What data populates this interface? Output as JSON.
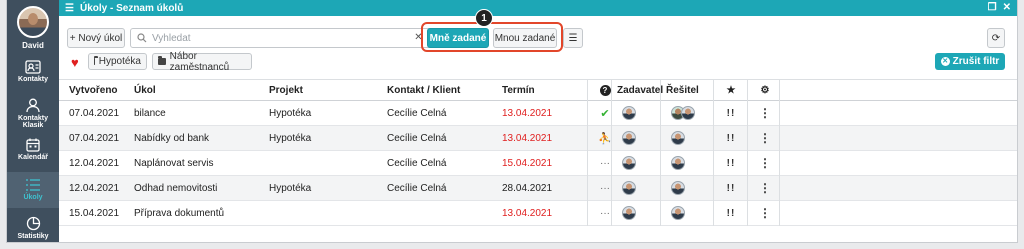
{
  "sidebar": {
    "user_name": "David",
    "items": [
      {
        "label": "Kontakty",
        "icon": "contacts-card-icon"
      },
      {
        "label": "Kontakty Klasik",
        "icon": "person-icon"
      },
      {
        "label": "Kalendář",
        "icon": "calendar-icon"
      },
      {
        "label": "Úkoly",
        "icon": "tasks-list-icon",
        "active": true
      },
      {
        "label": "Statistiky",
        "icon": "pie-chart-icon"
      }
    ]
  },
  "window": {
    "title": "Úkoly - Seznam úkolů",
    "accent_color": "#1da7b6"
  },
  "toolbar": {
    "new_task": "+ Nový úkol",
    "search_placeholder": "Vyhledat",
    "assigned_to_me": "Mně zadané",
    "assigned_by_me": "Mnou zadané",
    "badge": "1"
  },
  "filters": {
    "tags": [
      "Hypotéka",
      "Nábor zaměstnanců"
    ],
    "reset": "Zrušit filtr"
  },
  "table": {
    "columns": [
      "Vytvořeno",
      "Úkol",
      "Projekt",
      "Kontakt / Klient",
      "Termín",
      "?",
      "Zadavatel",
      "Řešitel",
      "★",
      "⚙"
    ],
    "rows": [
      {
        "created": "07.04.2021",
        "task": "bilance",
        "project": "Hypotéka",
        "contact": "Cecílie Celná",
        "deadline": "13.04.2021",
        "status": "done",
        "priority": "!!"
      },
      {
        "created": "07.04.2021",
        "task": "Nabídky od bank",
        "project": "Hypotéka",
        "contact": "Cecílie Celná",
        "deadline": "13.04.2021",
        "status": "in-progress",
        "priority": "!!"
      },
      {
        "created": "12.04.2021",
        "task": "Naplánovat servis",
        "project": "",
        "contact": "Cecílie Celná",
        "deadline": "15.04.2021",
        "status": "open",
        "priority": "!!"
      },
      {
        "created": "12.04.2021",
        "task": "Odhad nemovitosti",
        "project": "Hypotéka",
        "contact": "Cecílie Celná",
        "deadline": "28.04.2021",
        "status": "open",
        "priority": "!!"
      },
      {
        "created": "15.04.2021",
        "task": "Příprava dokumentů",
        "project": "",
        "contact": "",
        "deadline": "13.04.2021",
        "status": "open",
        "priority": "!!"
      }
    ],
    "status_icons": {
      "done": "✔",
      "in-progress": "⛹",
      "open": "···"
    },
    "deadline_colors": [
      "red",
      "red",
      "red",
      "black",
      "red"
    ],
    "solver_pairs": [
      2,
      1,
      1,
      1,
      1
    ]
  }
}
